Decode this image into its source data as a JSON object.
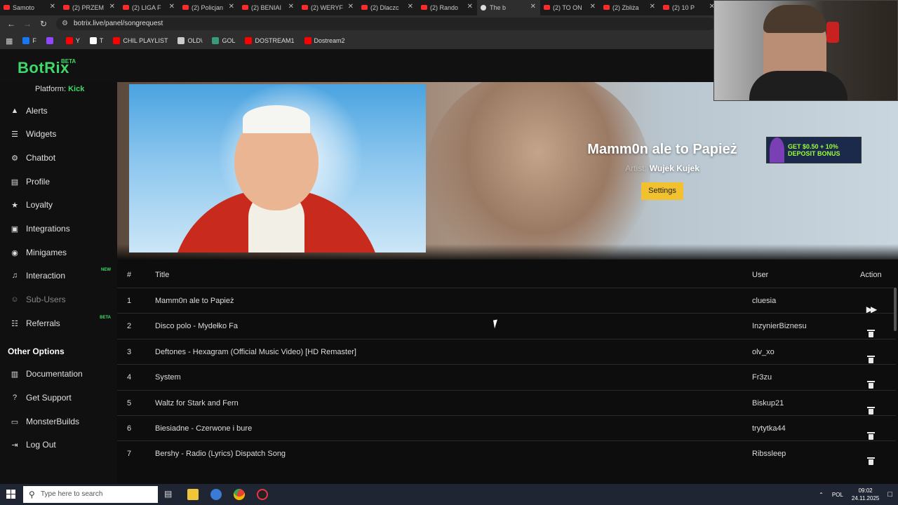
{
  "browser": {
    "tabs": [
      {
        "label": "Samoto",
        "active": false
      },
      {
        "label": "(2) PRZEM",
        "active": false
      },
      {
        "label": "(2) LIGA F",
        "active": false
      },
      {
        "label": "(2) Policjan",
        "active": false
      },
      {
        "label": "(2) BENIAI",
        "active": false
      },
      {
        "label": "(2) WERYF",
        "active": false
      },
      {
        "label": "(2) Dlaczc",
        "active": false
      },
      {
        "label": "(2) Rando",
        "active": false
      },
      {
        "label": "The b",
        "active": true
      },
      {
        "label": "(2) TO ON",
        "active": false
      },
      {
        "label": "(2) Zbliża",
        "active": false
      },
      {
        "label": "(2) 10 P",
        "active": false
      }
    ],
    "url": "botrix.live/panel/songrequest",
    "bookmarks": [
      {
        "label": "F",
        "icon": "facebook-icon",
        "color": "#1877f2"
      },
      {
        "label": "",
        "icon": "twitch-icon",
        "color": "#9146ff"
      },
      {
        "label": "Y",
        "icon": "youtube-icon",
        "color": "#ff0000"
      },
      {
        "label": "T",
        "icon": "x-icon",
        "color": "#ffffff"
      },
      {
        "label": "CHIL PLAYLIST",
        "icon": "youtube-icon",
        "color": "#ff0000"
      },
      {
        "label": "OLD\\",
        "icon": "folder-icon",
        "color": "#cccccc"
      },
      {
        "label": "GOL",
        "icon": "g-icon",
        "color": "#3a9a7a"
      },
      {
        "label": "DOSTREAM1",
        "icon": "youtube-icon",
        "color": "#ff0000"
      },
      {
        "label": "Dostream2",
        "icon": "youtube-icon",
        "color": "#ff0000"
      }
    ]
  },
  "app": {
    "logo": "BotRix",
    "logo_badge": "BETA",
    "platform_label": "Platform:",
    "platform_value": "Kick",
    "accent": "#3fd96a"
  },
  "sidebar": {
    "items": [
      {
        "label": "Alerts",
        "icon": "alert-triangle-icon",
        "badge": ""
      },
      {
        "label": "Widgets",
        "icon": "widgets-icon",
        "badge": ""
      },
      {
        "label": "Chatbot",
        "icon": "robot-icon",
        "badge": ""
      },
      {
        "label": "Profile",
        "icon": "profile-card-icon",
        "badge": ""
      },
      {
        "label": "Loyalty",
        "icon": "trophy-icon",
        "badge": ""
      },
      {
        "label": "Integrations",
        "icon": "integrations-icon",
        "badge": ""
      },
      {
        "label": "Minigames",
        "icon": "gamepad-icon",
        "badge": ""
      },
      {
        "label": "Interaction",
        "icon": "music-icon",
        "badge": "NEW"
      },
      {
        "label": "Sub-Users",
        "icon": "users-icon",
        "badge": ""
      },
      {
        "label": "Referrals",
        "icon": "referrals-icon",
        "badge": "BETA"
      }
    ],
    "other_heading": "Other Options",
    "other_items": [
      {
        "label": "Documentation",
        "icon": "book-icon"
      },
      {
        "label": "Get Support",
        "icon": "help-icon"
      },
      {
        "label": "MonsterBuilds",
        "icon": "laptop-icon"
      },
      {
        "label": "Log Out",
        "icon": "logout-icon"
      }
    ]
  },
  "now_playing": {
    "title": "Mamm0n ale to Papież",
    "artist_label": "Artist:",
    "artist": "Wujek Kujek",
    "settings_label": "Settings",
    "ad_text": "GET $0.50 + 10% DEPOSIT BONUS"
  },
  "queue": {
    "headers": {
      "num": "#",
      "title": "Title",
      "user": "User",
      "action": "Action"
    },
    "rows": [
      {
        "num": "1",
        "title": "Mamm0n ale to Papież",
        "user": "cluesia",
        "action": "skip"
      },
      {
        "num": "2",
        "title": "Disco polo - Mydełko Fa",
        "user": "InzynierBiznesu",
        "action": "delete"
      },
      {
        "num": "3",
        "title": "Deftones - Hexagram (Official Music Video) [HD Remaster]",
        "user": "olv_xo",
        "action": "delete"
      },
      {
        "num": "4",
        "title": "System",
        "user": "Fr3zu",
        "action": "delete"
      },
      {
        "num": "5",
        "title": "Waltz for Stark and Fern",
        "user": "Biskup21",
        "action": "delete"
      },
      {
        "num": "6",
        "title": "Biesiadne - Czerwone i bure",
        "user": "trytytka44",
        "action": "delete"
      },
      {
        "num": "7",
        "title": "Bershy - Radio (Lyrics) Dispatch Song",
        "user": "Ribssleep",
        "action": "delete"
      }
    ]
  },
  "taskbar": {
    "search_placeholder": "Type here to search",
    "lang": "POL",
    "time": "09:02",
    "date": "24.11.2025"
  }
}
